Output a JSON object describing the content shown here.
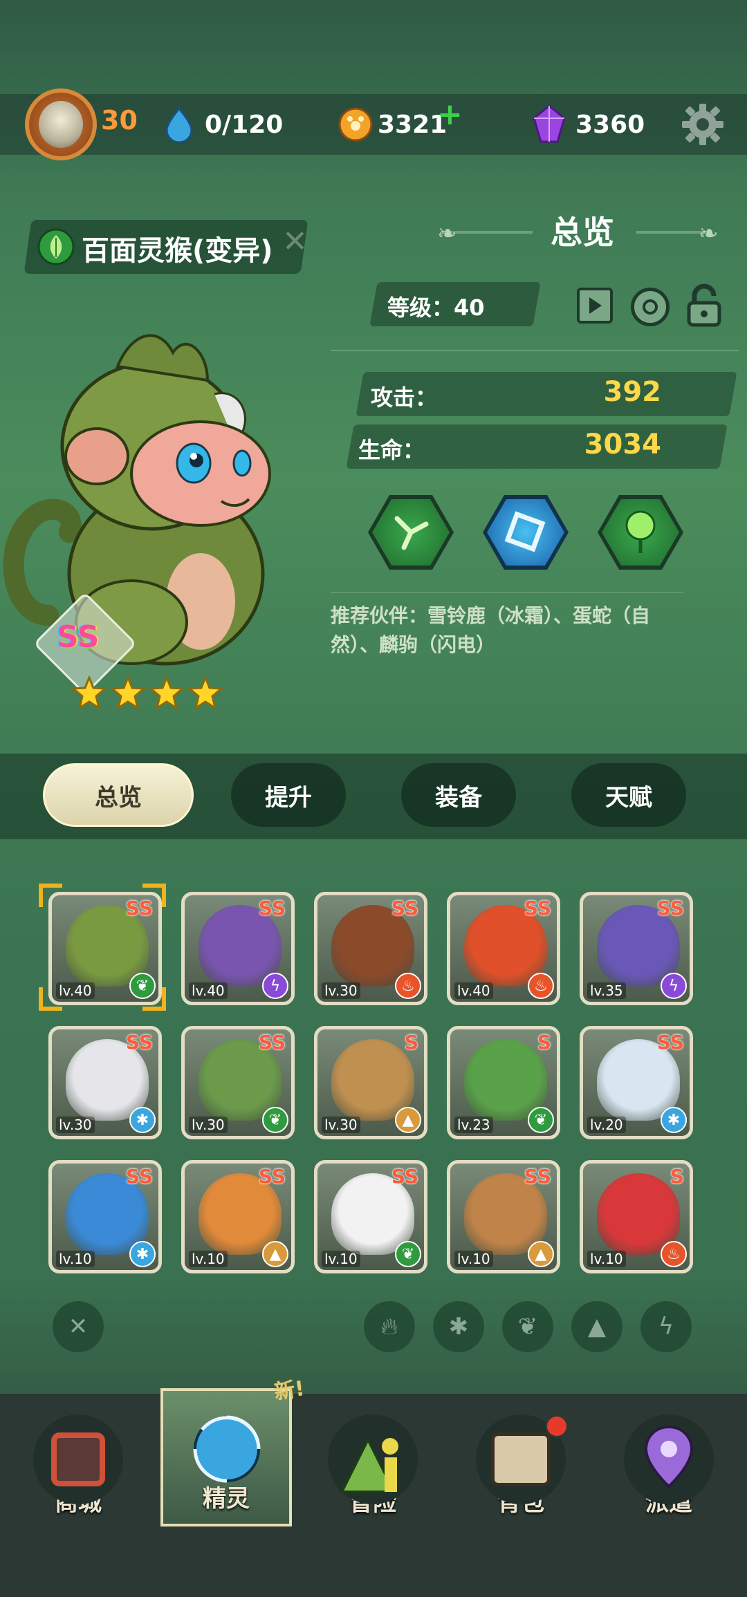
{
  "topbar": {
    "player_level": "30",
    "stamina": "0/120",
    "coins": "3321",
    "gems": "3360"
  },
  "spirit": {
    "name": "百面灵猴(变异)",
    "rank": "SS",
    "stars": 4
  },
  "panel": {
    "title": "总览",
    "level_text": "等级：40",
    "attack_label": "攻击：",
    "attack_value": "392",
    "hp_label": "生命：",
    "hp_value": "3034",
    "recommend": "推荐伙伴：雪铃鹿（冰霜）、蛋蛇（自然）、麟驹（闪电）"
  },
  "tabs": [
    "总览",
    "提升",
    "装备",
    "天赋"
  ],
  "cards": [
    {
      "rank": "SS",
      "lv": "lv.40",
      "elem": "leaf",
      "color": "#7a9a42"
    },
    {
      "rank": "SS",
      "lv": "lv.40",
      "elem": "bolt",
      "color": "#7a55b0"
    },
    {
      "rank": "SS",
      "lv": "lv.30",
      "elem": "fire",
      "color": "#8b4a2a"
    },
    {
      "rank": "SS",
      "lv": "lv.40",
      "elem": "fire",
      "color": "#e0502a"
    },
    {
      "rank": "SS",
      "lv": "lv.35",
      "elem": "bolt",
      "color": "#6a58b8"
    },
    {
      "rank": "SS",
      "lv": "lv.30",
      "elem": "ice",
      "color": "#e6e6ea"
    },
    {
      "rank": "SS",
      "lv": "lv.30",
      "elem": "leaf",
      "color": "#6a9a4a"
    },
    {
      "rank": "S",
      "lv": "lv.30",
      "elem": "earth",
      "color": "#c09050"
    },
    {
      "rank": "S",
      "lv": "lv.23",
      "elem": "leaf",
      "color": "#5aa24a"
    },
    {
      "rank": "SS",
      "lv": "lv.20",
      "elem": "ice",
      "color": "#d8e6f2"
    },
    {
      "rank": "SS",
      "lv": "lv.10",
      "elem": "ice",
      "color": "#3a8ad8"
    },
    {
      "rank": "SS",
      "lv": "lv.10",
      "elem": "earth",
      "color": "#e08a3a"
    },
    {
      "rank": "SS",
      "lv": "lv.10",
      "elem": "leaf",
      "color": "#f2f2f2"
    },
    {
      "rank": "SS",
      "lv": "lv.10",
      "elem": "earth",
      "color": "#c0844a"
    },
    {
      "rank": "S",
      "lv": "lv.10",
      "elem": "fire",
      "color": "#d8383a"
    }
  ],
  "filters": [
    "fire-icon",
    "snowflake-icon",
    "leaf-icon",
    "mountain-icon",
    "bolt-icon"
  ],
  "new_badge": "新!",
  "nav": [
    "商城",
    "精灵",
    "冒险",
    "背包",
    "派遣"
  ],
  "colors": {
    "accent_gold": "#ffd84a",
    "selected_border": "#f0b21d",
    "rank_red": "#ff5a3a"
  }
}
